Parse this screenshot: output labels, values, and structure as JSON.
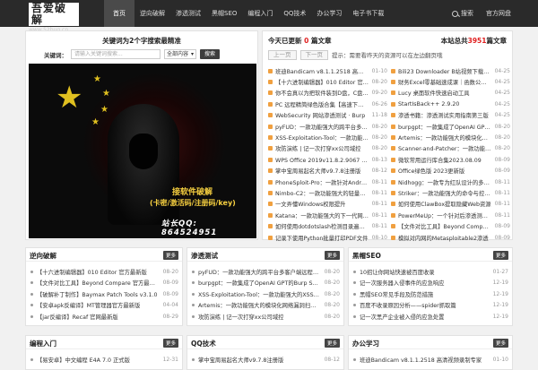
{
  "logo": {
    "line1": "吾爱破解",
    "line2": "www.52bug.cn"
  },
  "nav": [
    "首页",
    "逆向破解",
    "渗透测试",
    "黑帽SEO",
    "编程入门",
    "QQ技术",
    "办公学习",
    "电子书下载"
  ],
  "top_right": {
    "search": "搜索",
    "official": "官方网盘"
  },
  "feature": {
    "title": "关键词为2个字搜索最精准",
    "search_label": "关键词：",
    "search_placeholder": "请输入关键词搜索...",
    "select_value": "全部内容",
    "search_button": "搜索",
    "banner_line1": "接软件破解",
    "banner_line2": "(卡密/激活码/注册码/key)",
    "banner_line3": "站长QQ: 864524951"
  },
  "updates": {
    "today_prefix": "今天已更新",
    "today_count": "0",
    "today_suffix": "篇文章",
    "total_prefix": "本站总共",
    "total_count": "3951",
    "total_suffix": "篇文章",
    "prev": "上一页",
    "next": "下一页",
    "tip": "提示：需要看昨天的资源可以在左边翻页哦",
    "left": [
      {
        "t": "班迪Bandicam v8.1.1.2518 高清视频录",
        "d": "01-10"
      },
      {
        "t": "【十六进制编辑器】010 Editor 官方最",
        "d": "08-20"
      },
      {
        "t": "你不会真以为把软件装到D盘，C盘就不会满吧？",
        "d": "09-20"
      },
      {
        "t": "PC 远程精简绿色版合集【高速下载】",
        "d": "06-26"
      },
      {
        "t": "WebSecurity 网站渗透测试 · Burp",
        "d": "11-18"
      },
      {
        "t": "pyFUD：一款功能强大的跨平台多客户端",
        "d": "08-20"
      },
      {
        "t": "XSS-Exploitation-Tool：一款功能强大",
        "d": "08-20"
      },
      {
        "t": "攻防演练 | 记一次打穿xx公司域控",
        "d": "08-20"
      },
      {
        "t": "WPS Office 2019v11.8.2.9067 专业版",
        "d": "08-13"
      },
      {
        "t": "掌中宝周易起名大师v9.7.8注册版",
        "d": "08-12"
      },
      {
        "t": "PhoneSploit-Pro：一款针对Android设",
        "d": "08-11"
      },
      {
        "t": "Nimbo-C2：一款功能强大的轻量级C2框架",
        "d": "08-11"
      },
      {
        "t": "一文弄懂Windows权限提升",
        "d": "08-11"
      },
      {
        "t": "Katana：一款功能强大的下一代网络爬虫",
        "d": "08-11"
      },
      {
        "t": "如何使用dotdotslash检测目录遍历漏洞",
        "d": "08-11"
      },
      {
        "t": "记录下使用Python批量打印PDF文件",
        "d": "08-10"
      }
    ],
    "right": [
      {
        "t": "Bili23 Downloader B站视频下载工具",
        "d": "04-25"
      },
      {
        "t": "财务Excel零基础速成课｜函数公式+数",
        "d": "04-25"
      },
      {
        "t": "Lucy 桌面软件快速启动工具",
        "d": "04-25"
      },
      {
        "t": "StartIsBack++ 2.9.20",
        "d": "04-25"
      },
      {
        "t": "渗透书籍：渗透测试实用指南第三版",
        "d": "04-25"
      },
      {
        "t": "burpgpt：一款集成了OpenAI GPT的",
        "d": "08-20"
      },
      {
        "t": "Artemis：一款功能强大的模块化网络",
        "d": "08-20"
      },
      {
        "t": "Scanner-and-Patcher：一款功能强大",
        "d": "08-20"
      },
      {
        "t": "微软常用运行库合集2023.08.09",
        "d": "08-09"
      },
      {
        "t": "Office绿色版 2023更新版",
        "d": "08-09"
      },
      {
        "t": "Nidhogg：一款专为红队设计的多功能",
        "d": "08-11"
      },
      {
        "t": "Striker：一款功能强大的命令与控制C2",
        "d": "08-11"
      },
      {
        "t": "如何使用ClawBox提取隐藏Web资源",
        "d": "08-11"
      },
      {
        "t": "PowerMeUp：一个针对后渗透测试的",
        "d": "08-11"
      },
      {
        "t": "【文件对比工具】Beyond Compare 官方",
        "d": "08-09"
      },
      {
        "t": "模拟对内网的Metasploitable2渗透",
        "d": "08-09"
      }
    ]
  },
  "categories": [
    {
      "title": "逆向破解",
      "more": "更多",
      "items": [
        {
          "t": "【十六进制编辑器】010 Editor 官方最新版",
          "d": "08-20"
        },
        {
          "t": "【文件对比工具】Beyond Compare 官方最新版",
          "d": "08-09"
        },
        {
          "t": "【破解补丁制作】Baymax Patch Tools v3.1.0",
          "d": "08-09"
        },
        {
          "t": "【安卓apk反编译】MT管理器官方最新版",
          "d": "04-04"
        },
        {
          "t": "【jar反编译】Recaf 官网最新版",
          "d": "08-29"
        }
      ]
    },
    {
      "title": "渗透测试",
      "more": "更多",
      "items": [
        {
          "t": "pyFUD：一款功能强大的跨平台多客户端远程访问",
          "d": "08-20"
        },
        {
          "t": "burpgpt：一款集成了OpenAI GPT的Burp Suit...",
          "d": "08-20"
        },
        {
          "t": "XSS-Exploitation-Tool：一款功能强大的XSS漏...",
          "d": "08-20"
        },
        {
          "t": "Artemis：一款功能强大的模块化网络漏洞扫描和...",
          "d": "08-20"
        },
        {
          "t": "攻防演练 | 记一次打穿xx公司域控",
          "d": "08-20"
        }
      ]
    },
    {
      "title": "黑帽SEO",
      "more": "更多",
      "items": [
        {
          "t": "10招让你网站快速被百度收录",
          "d": "01-27"
        },
        {
          "t": "记一次服务器入侵事件的应急响应",
          "d": "12-19"
        },
        {
          "t": "黑帽SEO常见手段及防范措施",
          "d": "12-19"
        },
        {
          "t": "百度不收录原因分析——spider抓取篇",
          "d": "12-19"
        },
        {
          "t": "记一次黑产企业被入侵的应急处置",
          "d": "12-19"
        }
      ]
    },
    {
      "title": "编程入门",
      "more": "更多",
      "items": [
        {
          "t": "【易安卓】中文编程 E4A 7.0 正式版",
          "d": "12-31"
        }
      ]
    },
    {
      "title": "QQ技术",
      "more": "更多",
      "items": [
        {
          "t": "掌中宝周易起名大师v9.7.8注册版",
          "d": "08-12"
        }
      ]
    },
    {
      "title": "办公学习",
      "more": "更多",
      "items": [
        {
          "t": "班迪Bandicam v8.1.1.2518 高清视频录制专家",
          "d": "01-10"
        }
      ]
    }
  ]
}
